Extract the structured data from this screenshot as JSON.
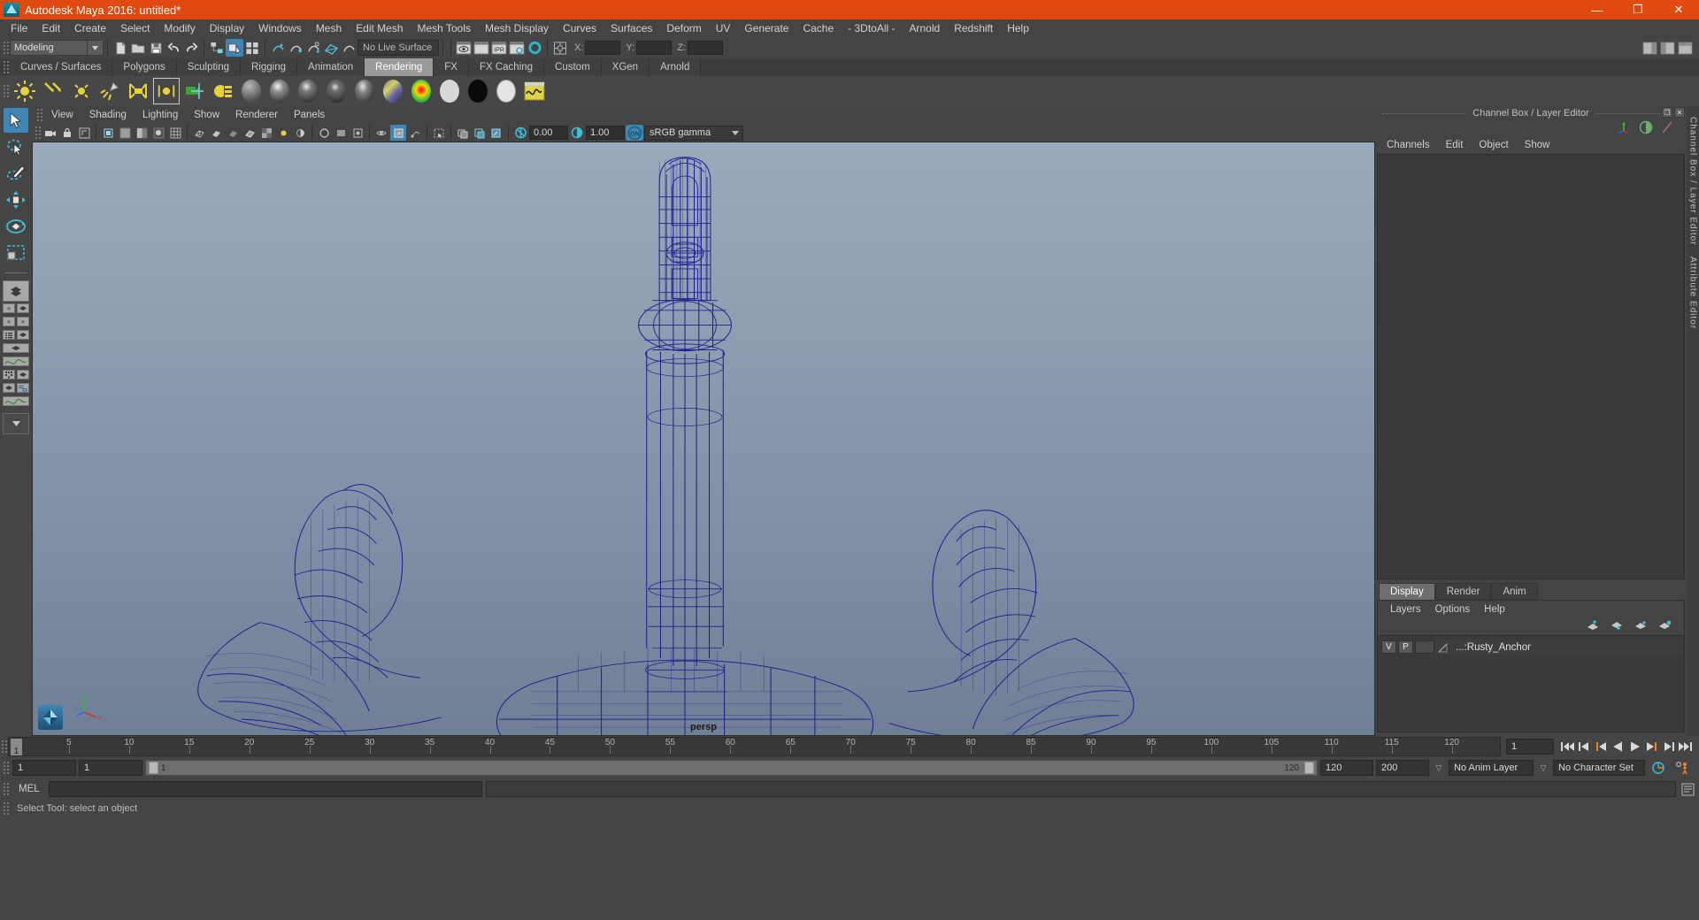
{
  "window": {
    "title": "Autodesk Maya 2016: untitled*",
    "logo_icon": "maya-logo-icon",
    "minimize": "—",
    "maximize": "❐",
    "close": "✕",
    "titlebar_color": "#e04a10"
  },
  "menubar": {
    "items": [
      "File",
      "Edit",
      "Create",
      "Select",
      "Modify",
      "Display",
      "Windows",
      "Mesh",
      "Edit Mesh",
      "Mesh Tools",
      "Mesh Display",
      "Curves",
      "Surfaces",
      "Deform",
      "UV",
      "Generate",
      "Cache",
      "- 3DtoAll -",
      "Arnold",
      "Redshift",
      "Help"
    ]
  },
  "statusline": {
    "mode": "Modeling",
    "mode_arrow": "▼",
    "live_surface": "No Live Surface",
    "coord_x_label": "X:",
    "coord_y_label": "Y:",
    "coord_z_label": "Z:",
    "coord_x_value": "",
    "coord_y_value": "",
    "coord_z_value": "",
    "icons": [
      "new-scene-icon",
      "open-scene-icon",
      "save-scene-icon",
      "undo-icon",
      "redo-icon",
      "select-by-hierarchy-icon",
      "select-by-object-icon",
      "select-by-component-icon",
      "snap-grid-icon",
      "snap-curve-icon",
      "snap-point-icon",
      "snap-projected-icon",
      "snap-view-plane-icon",
      "render-view-icon",
      "render-sequence-icon",
      "ipr-render-icon",
      "render-settings-icon",
      "hypershade-icon",
      "show-manipulator-icon"
    ]
  },
  "shelf": {
    "tabs": [
      "Curves / Surfaces",
      "Polygons",
      "Sculpting",
      "Rigging",
      "Animation",
      "Rendering",
      "FX",
      "FX Caching",
      "Custom",
      "XGen",
      "Arnold"
    ],
    "active_tab": "Rendering",
    "icons": [
      "ambient-light-icon",
      "directional-light-icon",
      "point-light-icon",
      "spot-light-icon",
      "area-light-icon",
      "volume-light-icon",
      "camera-icon",
      "render-layer-icon",
      "lambert-material-icon",
      "blinn-material-icon",
      "phong-material-icon",
      "phongE-material-icon",
      "anisotropic-material-icon",
      "layered-shader-icon",
      "ramp-shader-icon",
      "surface-shader-icon",
      "use-background-icon",
      "shading-map-icon",
      "hypershade-window-icon"
    ]
  },
  "toolbox": {
    "tools": [
      {
        "name": "select-tool",
        "selected": true
      },
      {
        "name": "lasso-select-tool",
        "selected": false
      },
      {
        "name": "paint-select-tool",
        "selected": false
      },
      {
        "name": "move-tool",
        "selected": false
      },
      {
        "name": "rotate-tool",
        "selected": false
      },
      {
        "name": "scale-tool",
        "selected": false
      }
    ],
    "layout_buttons": [
      "single-perspective-layout",
      "four-view-layout",
      "persp-outliner-layout",
      "persp-graph-editor-layout",
      "hypershade-persp-layout",
      "persp-render-view-layout",
      "outliner-persp-graph-layout",
      "more-layouts-dropdown"
    ]
  },
  "viewport": {
    "menus": [
      "View",
      "Shading",
      "Lighting",
      "Show",
      "Renderer",
      "Panels"
    ],
    "toolbar_icons": [
      "select-camera-icon",
      "lock-camera-icon",
      "camera-attributes-icon",
      "bookmark-icon",
      "image-plane-icon",
      "two-sided-lighting-icon",
      "shadows-icon",
      "grid-icon",
      "wireframe-icon",
      "smooth-shade-icon",
      "flat-shade-icon",
      "wireframe-on-shaded-icon",
      "texture-icon",
      "use-all-lights-icon",
      "shadow-map-icon",
      "ambient-occlusion-icon",
      "motion-blur-icon",
      "multisample-icon",
      "isolate-select-icon",
      "xray-icon",
      "xray-joints-icon",
      "xray-active-components-icon",
      "exposure-icon",
      "gamma-icon"
    ],
    "exposure_value": "0.00",
    "gamma_value": "1.00",
    "color_management": "sRGB gamma",
    "color_management_toggle": "ON",
    "camera_label": "persp",
    "axis_labels": {
      "x": "x",
      "y": "y",
      "z": "z"
    },
    "model": {
      "name": "Rusty_Anchor",
      "display_mode": "wireframe",
      "wire_color": "#1b1b8f",
      "bg_top_color": "#9aa9bc",
      "bg_bottom_color": "#6f8096"
    }
  },
  "channelbox": {
    "panel_title": "Channel Box / Layer Editor",
    "menus": [
      "Channels",
      "Edit",
      "Object",
      "Show"
    ],
    "header_icons": [
      "channel-box-icon",
      "attribute-editor-icon",
      "tool-settings-icon"
    ],
    "restore_btn": "❐",
    "close_btn": "✕"
  },
  "layereditor": {
    "tabs": [
      "Display",
      "Render",
      "Anim"
    ],
    "active_tab": "Display",
    "menus": [
      "Layers",
      "Options",
      "Help"
    ],
    "tool_icons": [
      "move-layer-up-icon",
      "move-layer-down-icon",
      "new-layer-icon",
      "new-layer-from-selected-icon"
    ],
    "layers": [
      {
        "visibility": "V",
        "playback": "P",
        "type": "",
        "color_swatch": "",
        "name": "...:Rusty_Anchor"
      }
    ]
  },
  "side_tabs": [
    "Channel Box / Layer Editor",
    "Attribute Editor"
  ],
  "timeline": {
    "ticks": [
      5,
      10,
      15,
      20,
      25,
      30,
      35,
      40,
      45,
      50,
      55,
      60,
      65,
      70,
      75,
      80,
      85,
      90,
      95,
      100,
      105,
      110,
      115,
      120
    ],
    "current_frame": "1",
    "frame_field": "1",
    "transport_icons": [
      "go-to-start-icon",
      "step-back-keyframe-icon",
      "step-back-frame-icon",
      "play-backwards-icon",
      "play-forwards-icon",
      "step-forward-frame-icon",
      "step-forward-keyframe-icon",
      "go-to-end-icon"
    ]
  },
  "rangeslider": {
    "anim_start": "1",
    "range_start": "1",
    "playback_start_label": "1",
    "playback_end_label": "120",
    "range_end": "120",
    "anim_end": "200",
    "anim_layer": "No Anim Layer",
    "character_set": "No Character Set",
    "auto_key_icon": "auto-keyframe-icon",
    "anim_prefs_icon": "animation-preferences-icon",
    "dropdown_arrow": "▽"
  },
  "commandline": {
    "language_label": "MEL",
    "input_value": "",
    "output_value": "",
    "script_editor_icon": "script-editor-icon"
  },
  "helpline": {
    "text": "Select Tool: select an object"
  }
}
